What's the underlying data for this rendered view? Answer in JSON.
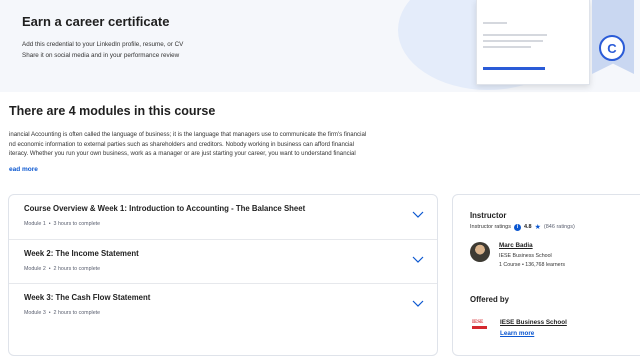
{
  "certificate": {
    "title": "Earn a career certificate",
    "line1": "Add this credential to your LinkedIn profile, resume, or CV",
    "line2": "Share it on social media and in your performance review",
    "badge_icon": "coursera-c-logo",
    "badge_letter": "C"
  },
  "modules_section": {
    "heading": "There are 4 modules in this course",
    "description_line1": "inancial Accounting is often called the language of business; it is the language that managers use to communicate the firm's financial",
    "description_line2": "nd economic information to external parties such as shareholders and creditors. Nobody working in business can afford financial",
    "description_line3": "iteracy. Whether you run your own business, work as a manager or are just starting your career, you want to understand financial",
    "read_more": "ead more",
    "modules": [
      {
        "title": "Course Overview & Week 1: Introduction to Accounting - The Balance Sheet",
        "module_label": "Module 1",
        "duration": "3 hours to complete"
      },
      {
        "title": "Week 2: The Income Statement",
        "module_label": "Module 2",
        "duration": "2 hours to complete"
      },
      {
        "title": "Week 3: The Cash Flow Statement",
        "module_label": "Module 3",
        "duration": "2 hours to complete"
      }
    ]
  },
  "instructor": {
    "heading": "Instructor",
    "ratings_label": "Instructor ratings",
    "rating": "4.8",
    "rating_count": "(846 ratings)",
    "name": "Marc Badia",
    "school": "IESE Business School",
    "stats": "1 Course  •  136,768 learners"
  },
  "offered_by": {
    "heading": "Offered by",
    "logo_text": "IESE",
    "name": "IESE Business School",
    "learn_more": "Learn more"
  },
  "colors": {
    "accent": "#0b57d0",
    "cert_band": "#f5f7fb",
    "iese_red": "#d4282f"
  }
}
